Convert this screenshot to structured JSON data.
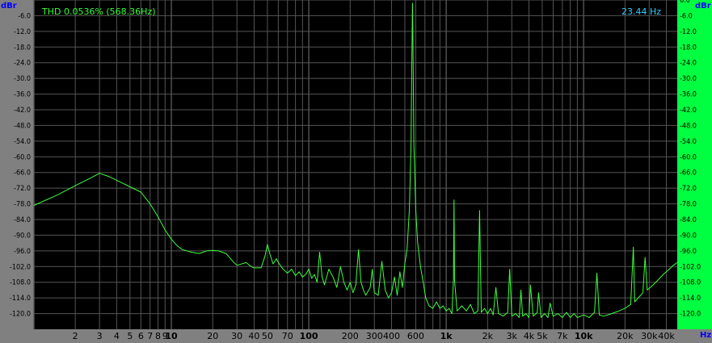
{
  "window": {
    "background": "#808080",
    "plot_background": "#000000",
    "right_axis_background": "#00FF40",
    "grid_color": "#555555",
    "trace_color": "#3CFF3C",
    "axis_title_color": "#0000FF",
    "readout_color": "#33FF33",
    "frequency_readout_color": "#33CCFF"
  },
  "chart_data": {
    "type": "line",
    "title": "",
    "xlabel": "Hz",
    "ylabel": "dBr",
    "ylabel_right": "dBr",
    "x_scale": "log",
    "xlim": [
      1,
      48000
    ],
    "ylim": [
      -126,
      0
    ],
    "grid": true,
    "thd_readout": "THD 0.0536% (568.36Hz)",
    "frequency_readout": "23.44 Hz",
    "y_ticks": [
      "-6.0",
      "-12.0",
      "-18.0",
      "-24.0",
      "-30.0",
      "-36.0",
      "-42.0",
      "-48.0",
      "-54.0",
      "-60.0",
      "-66.0",
      "-72.0",
      "-78.0",
      "-84.0",
      "-90.0",
      "-96.0",
      "-102.0",
      "-108.0",
      "-114.0",
      "-120.0"
    ],
    "y_tick_values": [
      -6,
      -12,
      -18,
      -24,
      -30,
      -36,
      -42,
      -48,
      -54,
      -60,
      -66,
      -72,
      -78,
      -84,
      -90,
      -96,
      -102,
      -108,
      -114,
      -120
    ],
    "y_ticks_right": [
      "6.0",
      "-6.0",
      "-12.0",
      "-18.0",
      "-24.0",
      "-30.0",
      "-36.0",
      "-42.0",
      "-48.0",
      "-54.0",
      "-60.0",
      "-66.0",
      "-72.0",
      "-78.0",
      "-84.0",
      "-90.0",
      "-96.0",
      "-102.0",
      "-108.0",
      "-114.0",
      "-120.0"
    ],
    "y_tick_values_right": [
      0,
      -6,
      -12,
      -18,
      -24,
      -30,
      -36,
      -42,
      -48,
      -54,
      -60,
      -66,
      -72,
      -78,
      -84,
      -90,
      -96,
      -102,
      -108,
      -114,
      -120
    ],
    "x_ticks": [
      {
        "label": "2",
        "value": 2
      },
      {
        "label": "3",
        "value": 3
      },
      {
        "label": "4",
        "value": 4
      },
      {
        "label": "5",
        "value": 5
      },
      {
        "label": "6",
        "value": 6
      },
      {
        "label": "7",
        "value": 7
      },
      {
        "label": "8",
        "value": 8
      },
      {
        "label": "9",
        "value": 9
      },
      {
        "label": "10",
        "value": 10,
        "major": true
      },
      {
        "label": "20",
        "value": 20
      },
      {
        "label": "30",
        "value": 30
      },
      {
        "label": "40",
        "value": 40
      },
      {
        "label": "50",
        "value": 50
      },
      {
        "label": "70",
        "value": 70
      },
      {
        "label": "100",
        "value": 100,
        "major": true
      },
      {
        "label": "200",
        "value": 200
      },
      {
        "label": "300",
        "value": 300
      },
      {
        "label": "400",
        "value": 400
      },
      {
        "label": "600",
        "value": 600
      },
      {
        "label": "1k",
        "value": 1000,
        "major": true
      },
      {
        "label": "2k",
        "value": 2000
      },
      {
        "label": "3k",
        "value": 3000
      },
      {
        "label": "4k",
        "value": 4000
      },
      {
        "label": "5k",
        "value": 5000
      },
      {
        "label": "7k",
        "value": 7000
      },
      {
        "label": "10k",
        "value": 10000,
        "major": true
      },
      {
        "label": "20k",
        "value": 20000
      },
      {
        "label": "30k",
        "value": 30000
      },
      {
        "label": "40k",
        "value": 40000
      }
    ],
    "series": [
      {
        "values": [
          [
            1.0,
            -78.6
          ],
          [
            1.5,
            -74.5
          ],
          [
            2.0,
            -71.0
          ],
          [
            2.5,
            -68.5
          ],
          [
            3.0,
            -66.3
          ],
          [
            3.5,
            -67.5
          ],
          [
            4.0,
            -69.0
          ],
          [
            5.0,
            -71.5
          ],
          [
            6.0,
            -73.5
          ],
          [
            7.0,
            -78.0
          ],
          [
            8.0,
            -83.0
          ],
          [
            9.0,
            -88.0
          ],
          [
            10.0,
            -91.5
          ],
          [
            11.0,
            -94.0
          ],
          [
            12.0,
            -95.5
          ],
          [
            14.0,
            -96.5
          ],
          [
            16.0,
            -97.0
          ],
          [
            18.0,
            -96.0
          ],
          [
            20.0,
            -95.8
          ],
          [
            22.0,
            -96.0
          ],
          [
            25.0,
            -97.0
          ],
          [
            28.0,
            -100.0
          ],
          [
            30.0,
            -101.5
          ],
          [
            35.0,
            -100.5
          ],
          [
            38.0,
            -102.0
          ],
          [
            40.0,
            -102.5
          ],
          [
            45.0,
            -102.5
          ],
          [
            48.0,
            -98.0
          ],
          [
            50.0,
            -93.5
          ],
          [
            52.0,
            -97.0
          ],
          [
            55.0,
            -101.0
          ],
          [
            58.0,
            -99.0
          ],
          [
            60.0,
            -100.5
          ],
          [
            65.0,
            -103.0
          ],
          [
            70.0,
            -104.5
          ],
          [
            75.0,
            -103.0
          ],
          [
            80.0,
            -105.5
          ],
          [
            85.0,
            -104.0
          ],
          [
            90.0,
            -106.0
          ],
          [
            95.0,
            -105.0
          ],
          [
            100.0,
            -103.0
          ],
          [
            105.0,
            -106.5
          ],
          [
            110.0,
            -105.0
          ],
          [
            115.0,
            -108.0
          ],
          [
            120.0,
            -96.5
          ],
          [
            125.0,
            -106.0
          ],
          [
            130.0,
            -109.0
          ],
          [
            140.0,
            -103.0
          ],
          [
            150.0,
            -106.0
          ],
          [
            160.0,
            -110.0
          ],
          [
            170.0,
            -102.0
          ],
          [
            180.0,
            -108.0
          ],
          [
            190.0,
            -111.0
          ],
          [
            200.0,
            -108.0
          ],
          [
            210.0,
            -112.0
          ],
          [
            220.0,
            -109.0
          ],
          [
            230.0,
            -95.5
          ],
          [
            240.0,
            -108.0
          ],
          [
            250.0,
            -111.0
          ],
          [
            260.0,
            -113.0
          ],
          [
            280.0,
            -110.0
          ],
          [
            290.0,
            -103.0
          ],
          [
            300.0,
            -112.0
          ],
          [
            320.0,
            -113.0
          ],
          [
            340.0,
            -100.0
          ],
          [
            360.0,
            -111.0
          ],
          [
            380.0,
            -114.0
          ],
          [
            400.0,
            -112.0
          ],
          [
            420.0,
            -106.0
          ],
          [
            440.0,
            -113.0
          ],
          [
            460.0,
            -104.0
          ],
          [
            480.0,
            -110.0
          ],
          [
            500.0,
            -101.0
          ],
          [
            520.0,
            -95.0
          ],
          [
            540.0,
            -80.0
          ],
          [
            555.0,
            -55.0
          ],
          [
            563.0,
            -20.0
          ],
          [
            568.36,
            -1.2
          ],
          [
            574.0,
            -20.0
          ],
          [
            582.0,
            -55.0
          ],
          [
            600.0,
            -80.0
          ],
          [
            620.0,
            -93.0
          ],
          [
            650.0,
            -102.0
          ],
          [
            680.0,
            -108.0
          ],
          [
            710.0,
            -114.0
          ],
          [
            750.0,
            -117.0
          ],
          [
            800.0,
            -118.0
          ],
          [
            850.0,
            -115.5
          ],
          [
            900.0,
            -118.0
          ],
          [
            950.0,
            -117.0
          ],
          [
            1000.0,
            -119.0
          ],
          [
            1050.0,
            -118.0
          ],
          [
            1100.0,
            -120.0
          ],
          [
            1130.0,
            -107.0
          ],
          [
            1140.0,
            -76.5
          ],
          [
            1150.0,
            -107.0
          ],
          [
            1200.0,
            -119.0
          ],
          [
            1300.0,
            -117.0
          ],
          [
            1400.0,
            -119.0
          ],
          [
            1500.0,
            -116.5
          ],
          [
            1600.0,
            -120.0
          ],
          [
            1700.0,
            -119.0
          ],
          [
            1750.0,
            -80.5
          ],
          [
            1800.0,
            -119.5
          ],
          [
            1900.0,
            -118.0
          ],
          [
            2000.0,
            -120.0
          ],
          [
            2100.0,
            -118.0
          ],
          [
            2200.0,
            -120.5
          ],
          [
            2300.0,
            -110.0
          ],
          [
            2400.0,
            -120.0
          ],
          [
            2600.0,
            -121.0
          ],
          [
            2800.0,
            -119.5
          ],
          [
            2900.0,
            -103.0
          ],
          [
            3000.0,
            -121.0
          ],
          [
            3200.0,
            -120.0
          ],
          [
            3400.0,
            -121.5
          ],
          [
            3500.0,
            -111.0
          ],
          [
            3600.0,
            -121.0
          ],
          [
            3800.0,
            -120.0
          ],
          [
            4000.0,
            -121.5
          ],
          [
            4100.0,
            -109.0
          ],
          [
            4300.0,
            -121.0
          ],
          [
            4600.0,
            -119.5
          ],
          [
            4700.0,
            -112.0
          ],
          [
            4900.0,
            -121.5
          ],
          [
            5200.0,
            -120.0
          ],
          [
            5500.0,
            -121.5
          ],
          [
            5700.0,
            -116.0
          ],
          [
            6000.0,
            -121.0
          ],
          [
            6500.0,
            -120.0
          ],
          [
            7000.0,
            -121.5
          ],
          [
            7500.0,
            -119.5
          ],
          [
            8000.0,
            -121.5
          ],
          [
            8500.0,
            -120.0
          ],
          [
            9000.0,
            -121.5
          ],
          [
            10000.0,
            -120.5
          ],
          [
            11000.0,
            -121.5
          ],
          [
            12000.0,
            -119.5
          ],
          [
            12500.0,
            -104.5
          ],
          [
            13000.0,
            -120.5
          ],
          [
            14000.0,
            -121.0
          ],
          [
            16000.0,
            -120.0
          ],
          [
            18000.0,
            -119.0
          ],
          [
            20000.0,
            -118.0
          ],
          [
            22000.0,
            -116.5
          ],
          [
            23000.0,
            -94.5
          ],
          [
            23500.0,
            -115.5
          ],
          [
            25000.0,
            -114.0
          ],
          [
            27000.0,
            -112.0
          ],
          [
            28000.0,
            -98.5
          ],
          [
            29000.0,
            -111.0
          ],
          [
            32000.0,
            -109.0
          ],
          [
            35000.0,
            -107.0
          ],
          [
            38000.0,
            -105.0
          ],
          [
            42000.0,
            -103.0
          ],
          [
            45000.0,
            -101.5
          ],
          [
            48000.0,
            -100.5
          ]
        ]
      }
    ]
  }
}
